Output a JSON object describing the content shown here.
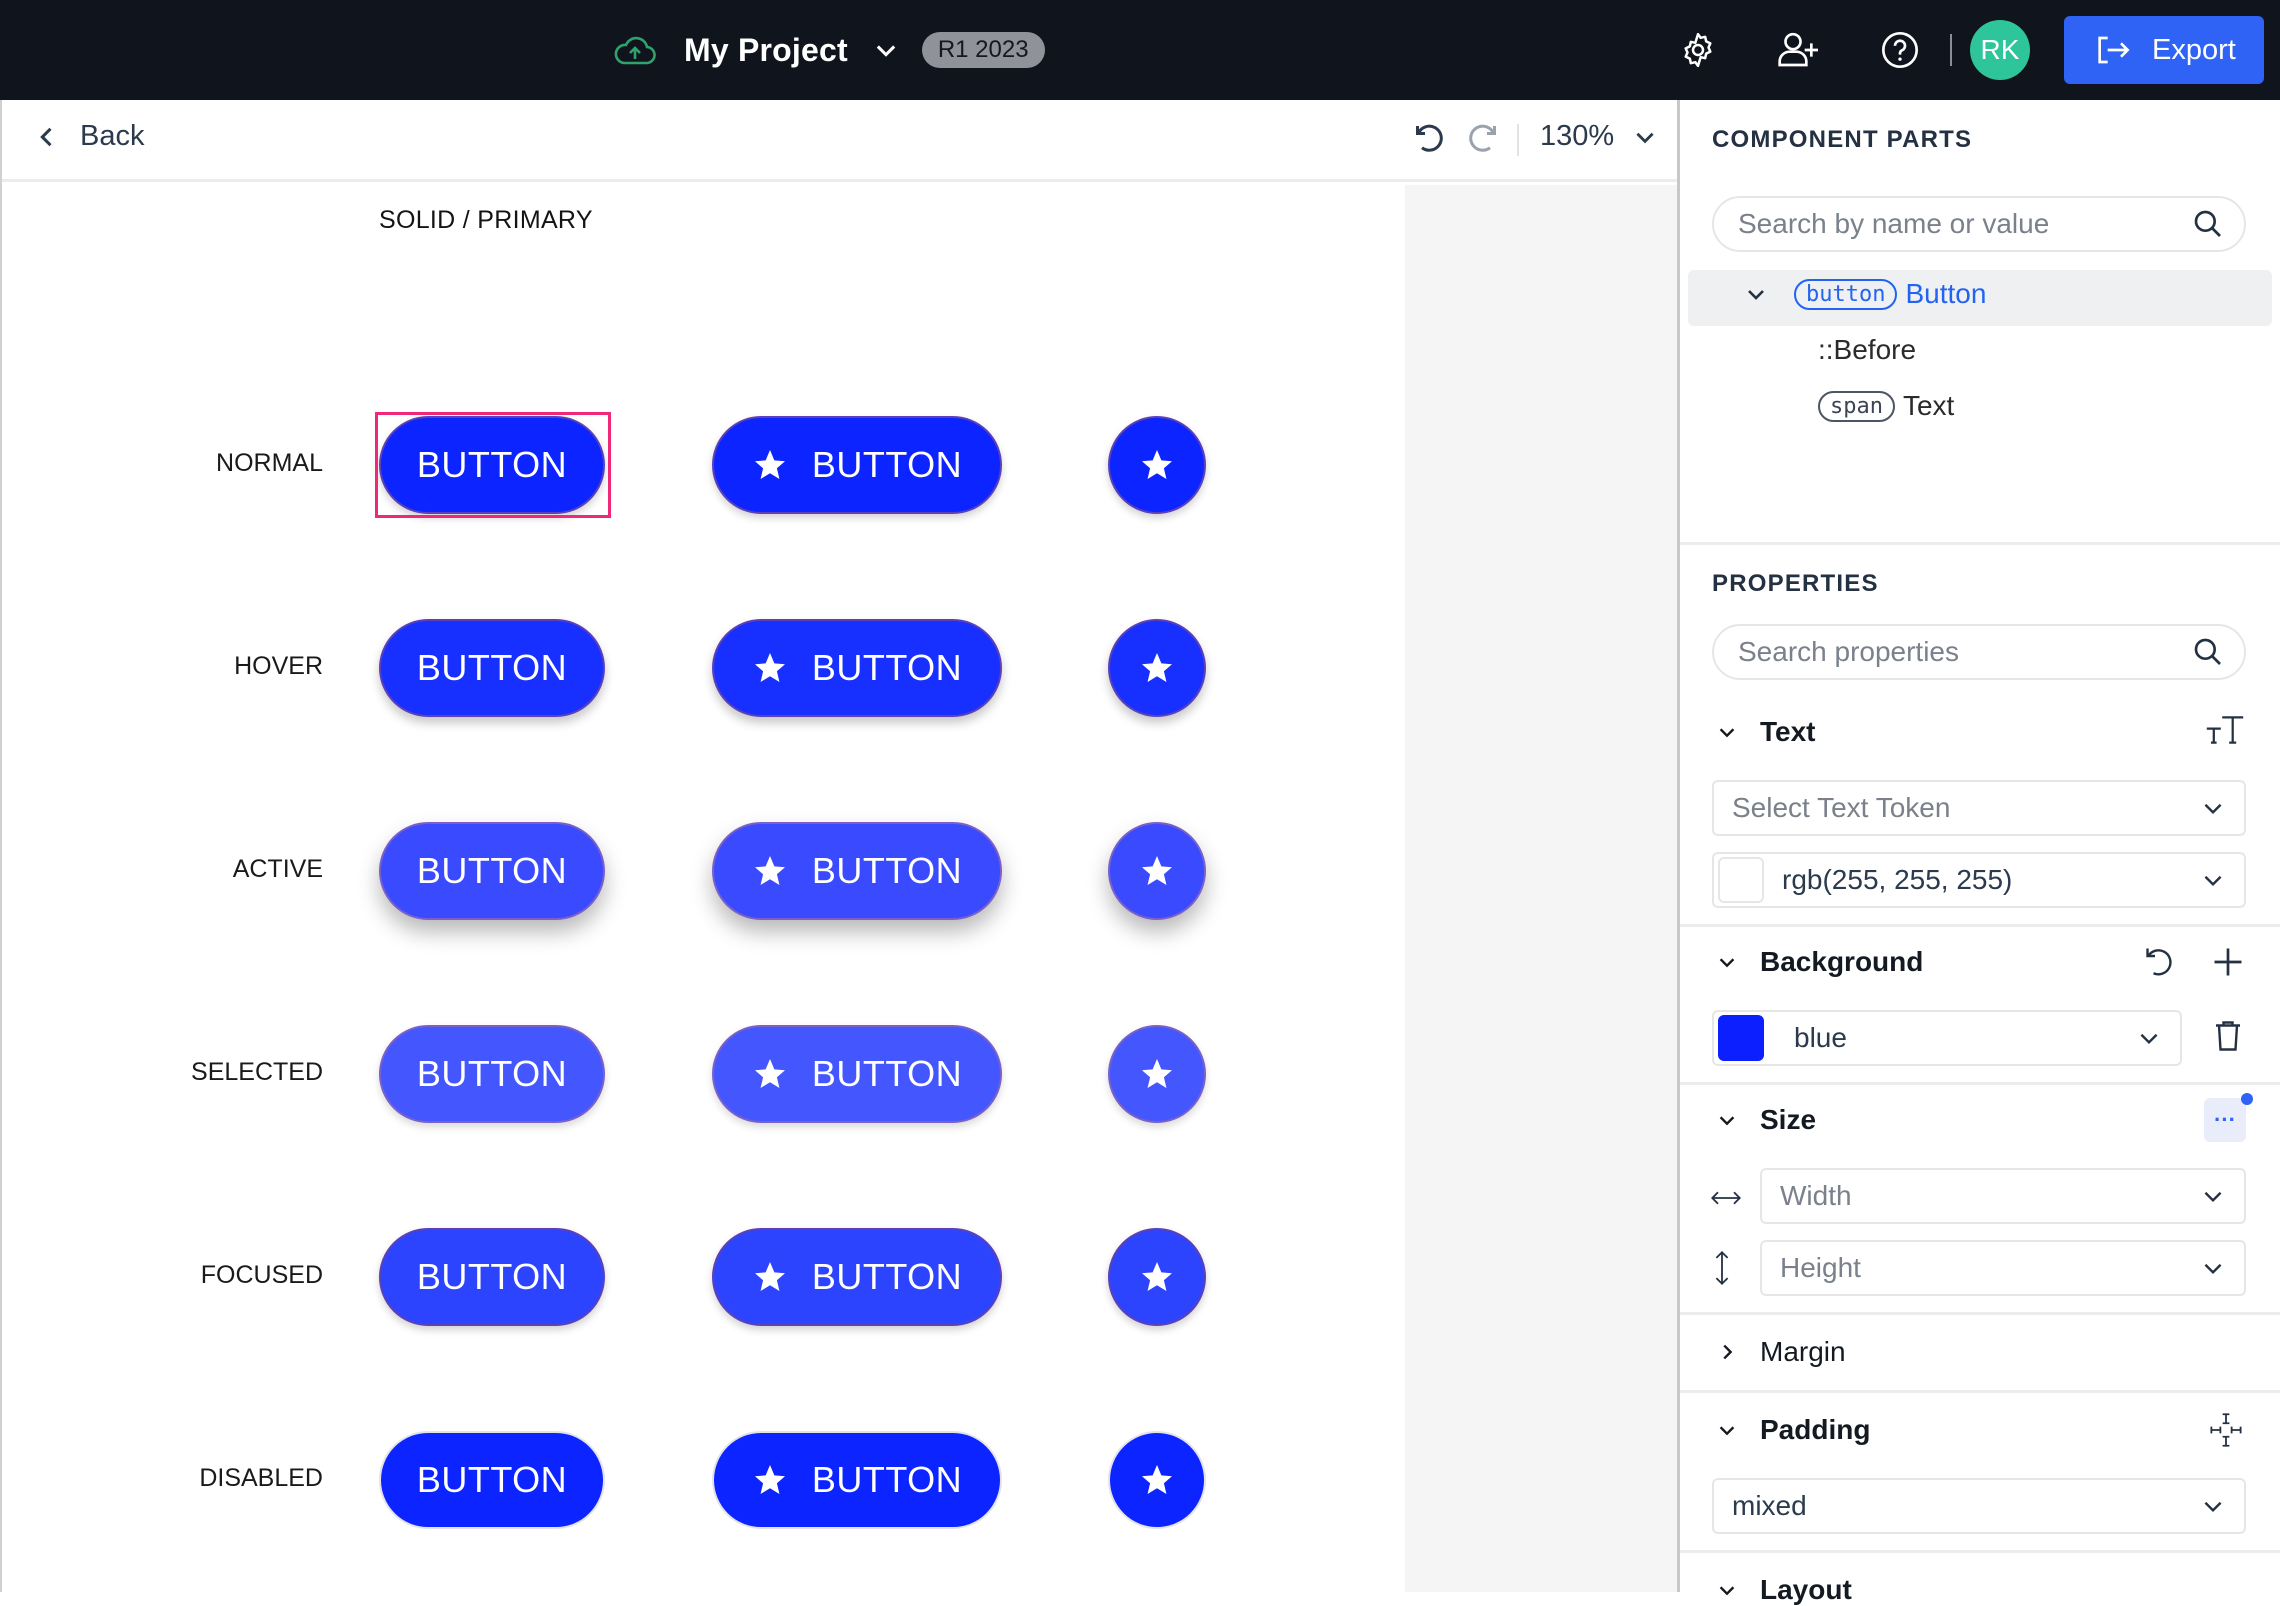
{
  "topbar": {
    "project_name": "My Project",
    "release_badge": "R1 2023",
    "avatar_initials": "RK",
    "export_label": "Export",
    "colors": {
      "background": "#10151d",
      "accent": "#2e63f5",
      "avatar": "#2fc59a",
      "cloud": "#2fa36b"
    }
  },
  "canvas_toolbar": {
    "back_label": "Back",
    "zoom_level": "130%"
  },
  "canvas": {
    "section_title": "SOLID / PRIMARY",
    "button_label": "BUTTON",
    "states": [
      "NORMAL",
      "HOVER",
      "ACTIVE",
      "SELECTED",
      "FOCUSED",
      "DISABLED"
    ],
    "variants": [
      "text",
      "icon-text",
      "icon-only"
    ],
    "selected_state": "NORMAL",
    "selected_variant": "text"
  },
  "component_parts": {
    "heading": "COMPONENT PARTS",
    "search_placeholder": "Search by name or value",
    "tree": [
      {
        "tag": "button",
        "label": "Button",
        "selected": true,
        "expanded": true
      },
      {
        "tag": "",
        "label": "::Before",
        "selected": false
      },
      {
        "tag": "span",
        "label": "Text",
        "selected": false
      }
    ]
  },
  "properties": {
    "heading": "PROPERTIES",
    "search_placeholder": "Search properties",
    "text": {
      "label": "Text",
      "token_placeholder": "Select Text Token",
      "color_value": "rgb(255, 255, 255)",
      "color_swatch": "#ffffff"
    },
    "background": {
      "label": "Background",
      "value": "blue",
      "swatch": "#0c1fff"
    },
    "size": {
      "label": "Size",
      "width_placeholder": "Width",
      "height_placeholder": "Height",
      "more_label": "···"
    },
    "margin": {
      "label": "Margin"
    },
    "padding": {
      "label": "Padding",
      "value": "mixed"
    },
    "layout": {
      "label": "Layout"
    }
  }
}
